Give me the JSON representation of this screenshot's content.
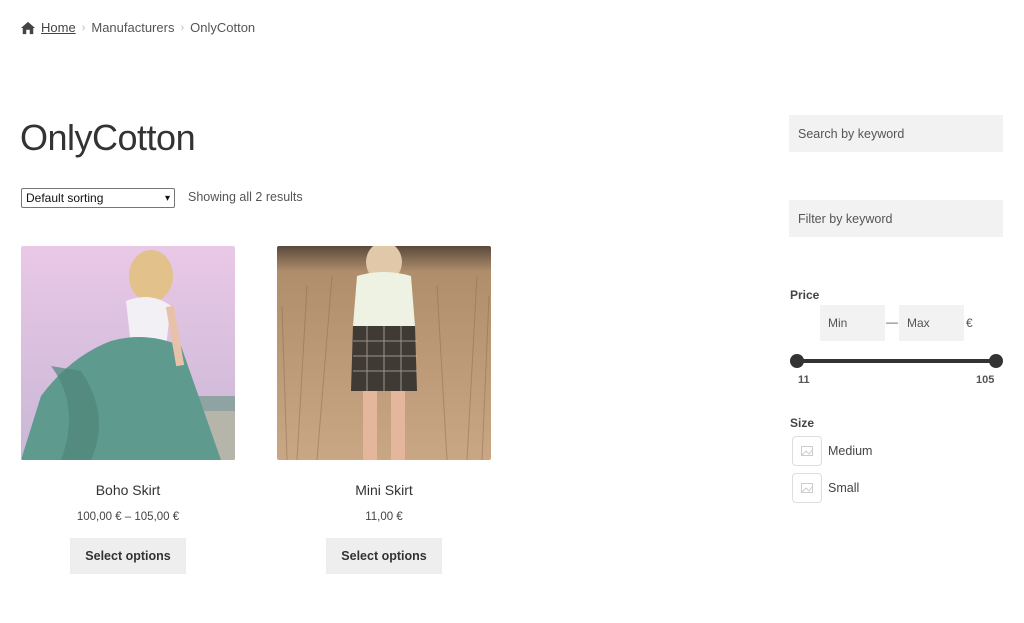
{
  "breadcrumb": {
    "home_icon": "home-icon",
    "home": "Home",
    "manufacturers": "Manufacturers",
    "current": "OnlyCotton"
  },
  "page": {
    "title": "OnlyCotton"
  },
  "shop": {
    "sorting_selected": "Default sorting",
    "result_count": "Showing all 2 results"
  },
  "products": [
    {
      "name": "Boho Skirt",
      "price": "100,00 € – 105,00 €",
      "button": "Select options"
    },
    {
      "name": "Mini Skirt",
      "price": "11,00 €",
      "button": "Select options"
    }
  ],
  "sidebar": {
    "search_placeholder": "Search by keyword",
    "filter_placeholder": "Filter by keyword",
    "price": {
      "label": "Price",
      "min_placeholder": "Min",
      "max_placeholder": "Max",
      "dash": "—",
      "currency": "€",
      "range_min": "11",
      "range_max": "105"
    },
    "size": {
      "label": "Size",
      "options": [
        "Medium",
        "Small"
      ]
    }
  }
}
